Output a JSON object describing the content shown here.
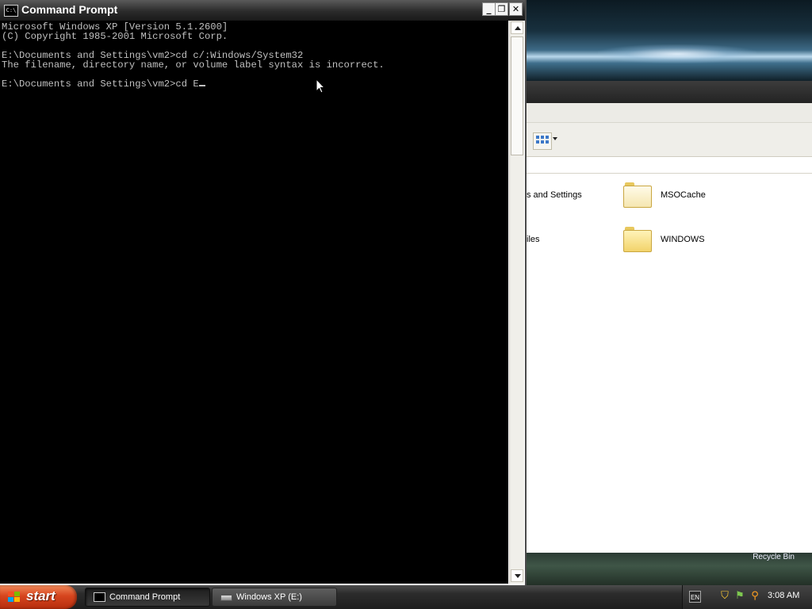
{
  "cmd": {
    "title": "Command Prompt",
    "icon_label": "C:\\",
    "lines": [
      "Microsoft Windows XP [Version 5.1.2600]",
      "(C) Copyright 1985-2001 Microsoft Corp.",
      "",
      "E:\\Documents and Settings\\vm2>cd c/:Windows/System32",
      "The filename, directory name, or volume label syntax is incorrect.",
      "",
      "E:\\Documents and Settings\\vm2>cd E"
    ],
    "controls": {
      "minimize": "_",
      "restore": "❐",
      "close": "✕"
    }
  },
  "explorer": {
    "items": [
      {
        "label": "s and Settings"
      },
      {
        "label": "MSOCache"
      },
      {
        "label": "iles"
      },
      {
        "label": "WINDOWS"
      }
    ]
  },
  "desktop": {
    "recycle_bin_label": "Recycle Bin"
  },
  "taskbar": {
    "start_label": "start",
    "tasks": [
      {
        "label": "Command Prompt",
        "icon": "cmd-icon",
        "active": true
      },
      {
        "label": "Windows XP (E:)",
        "icon": "drive-icon",
        "active": false
      }
    ],
    "tray": {
      "language": "EN",
      "clock": "3:08 AM"
    }
  },
  "colors": {
    "console_bg": "#000000",
    "console_text": "#c0c0c0",
    "start_button": "#d6451e"
  }
}
